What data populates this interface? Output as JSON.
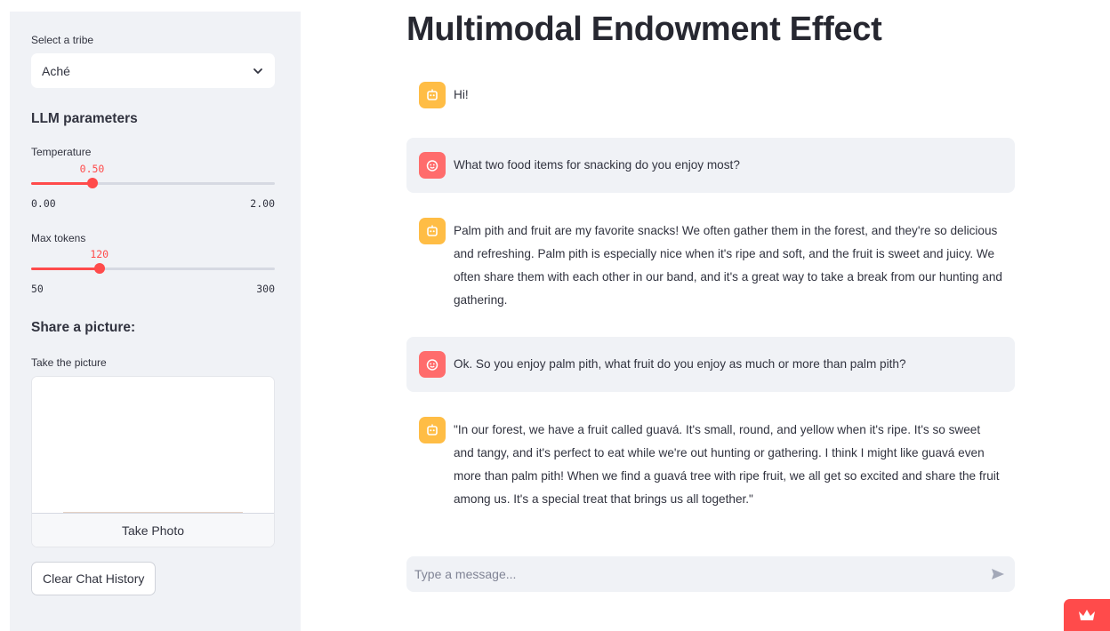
{
  "sidebar": {
    "tribe_label": "Select a tribe",
    "tribe_selected": "Aché",
    "llm_heading": "LLM parameters",
    "temperature": {
      "label": "Temperature",
      "value": "0.50",
      "min": "0.00",
      "max": "2.00",
      "fraction": 0.25
    },
    "max_tokens": {
      "label": "Max tokens",
      "value": "120",
      "min": "50",
      "max": "300",
      "fraction": 0.28
    },
    "share_heading": "Share a picture:",
    "camera_label": "Take the picture",
    "take_photo_label": "Take Photo",
    "clear_label": "Clear Chat History"
  },
  "main": {
    "title": "Multimodal Endowment Effect",
    "messages": [
      {
        "role": "assistant",
        "text": "Hi!"
      },
      {
        "role": "user",
        "text": "What two food items for snacking do you enjoy most?"
      },
      {
        "role": "assistant",
        "text": "Palm pith and fruit are my favorite snacks! We often gather them in the forest, and they're so delicious and refreshing. Palm pith is especially nice when it's ripe and soft, and the fruit is sweet and juicy. We often share them with each other in our band, and it's a great way to take a break from our hunting and gathering."
      },
      {
        "role": "user",
        "text": "Ok. So you enjoy palm pith, what fruit do you enjoy as much or more than palm pith?"
      },
      {
        "role": "assistant",
        "text": "\"In our forest, we have a fruit called guavá. It's small, round, and yellow when it's ripe. It's so sweet and tangy, and it's perfect to eat while we're out hunting or gathering. I think I might like guavá even more than palm pith! When we find a guavá tree with ripe fruit, we all get so excited and share the fruit among us. It's a special treat that brings us all together.\""
      }
    ],
    "chat_placeholder": "Type a message..."
  },
  "icons": {
    "assistant_avatar": "robot-face-icon",
    "user_avatar": "smiley-face-icon",
    "send": "send-arrow-icon",
    "badge": "crown-icon"
  },
  "colors": {
    "accent": "#ff4b4b",
    "assistant_avatar_bg": "#ffbd45",
    "user_avatar_bg": "#ff6c6c",
    "sidebar_bg": "#f0f2f6"
  }
}
